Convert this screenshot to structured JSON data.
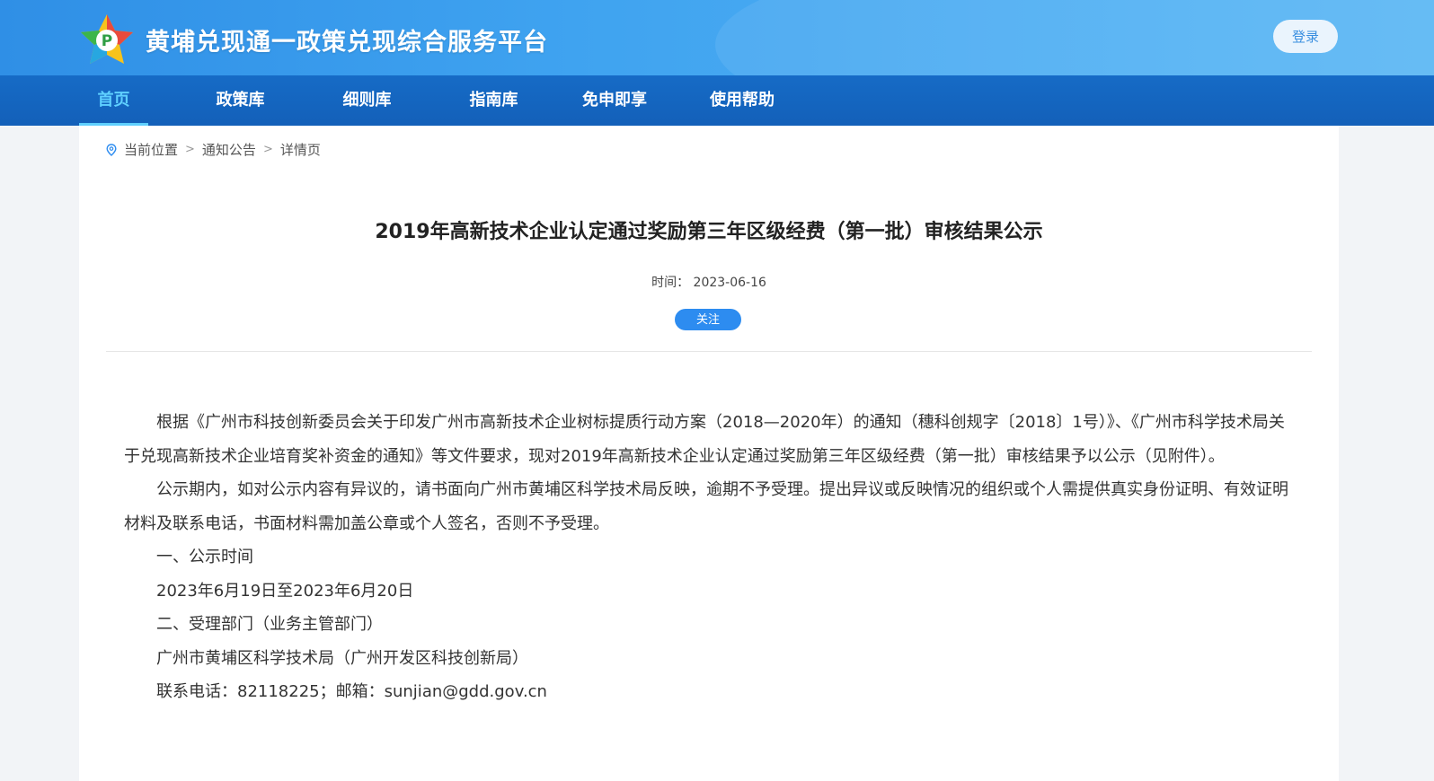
{
  "header": {
    "site_title": "黄埔兑现通一政策兑现综合服务平台",
    "login_label": "登录",
    "logo_icon": "star-p-logo-icon"
  },
  "nav": {
    "items": [
      {
        "label": "首页",
        "active": true
      },
      {
        "label": "政策库"
      },
      {
        "label": "细则库"
      },
      {
        "label": "指南库"
      },
      {
        "label": "免申即享"
      },
      {
        "label": "使用帮助"
      }
    ]
  },
  "breadcrumb": {
    "icon": "location-pin-icon",
    "items": [
      "当前位置",
      "通知公告",
      "详情页"
    ],
    "separator": ">"
  },
  "article": {
    "title": "2019年高新技术企业认定通过奖励第三年区级经费（第一批）审核结果公示",
    "time_label": "时间：",
    "time_value": "2023-06-16",
    "follow_label": "关注",
    "paragraphs": [
      "根据《广州市科技创新委员会关于印发广州市高新技术企业树标提质行动方案（2018—2020年）的通知（穗科创规字〔2018〕1号）》、《广州市科学技术局关于兑现高新技术企业培育奖补资金的通知》等文件要求，现对2019年高新技术企业认定通过奖励第三年区级经费（第一批）审核结果予以公示（见附件）。",
      "公示期内，如对公示内容有异议的，请书面向广州市黄埔区科学技术局反映，逾期不予受理。提出异议或反映情况的组织或个人需提供真实身份证明、有效证明材料及联系电话，书面材料需加盖公章或个人签名，否则不予受理。",
      "一、公示时间",
      "2023年6月19日至2023年6月20日",
      "二、受理部门（业务主管部门）",
      "广州市黄埔区科学技术局（广州开发区科技创新局）",
      "联系电话：82118225；邮箱：sunjian@gdd.gov.cn"
    ]
  },
  "colors": {
    "header_blue": "#3fa3f0",
    "nav_blue": "#1565c0",
    "nav_active": "#5fd0ff",
    "button_blue": "#2d8cf0"
  }
}
